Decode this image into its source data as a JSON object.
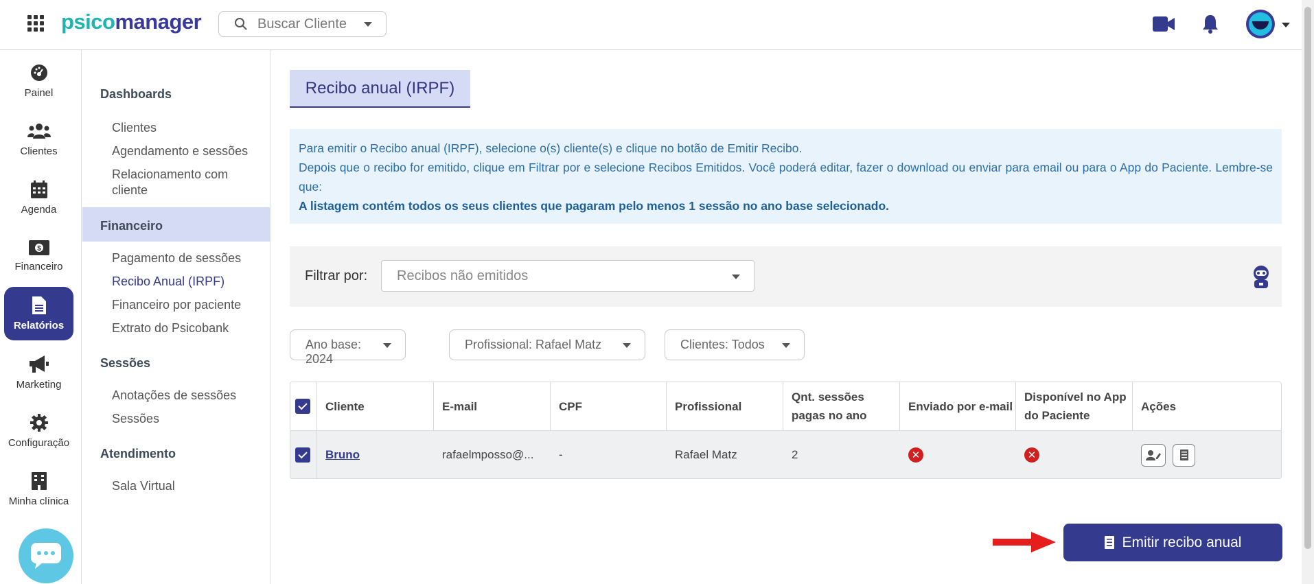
{
  "app": {
    "logo_a": "psico",
    "logo_b": "manager"
  },
  "search": {
    "placeholder": "Buscar Cliente"
  },
  "leftnav": [
    {
      "label": "Painel",
      "icon": "dashboard-gauge-icon"
    },
    {
      "label": "Clientes",
      "icon": "users-icon"
    },
    {
      "label": "Agenda",
      "icon": "calendar-icon"
    },
    {
      "label": "Financeiro",
      "icon": "money-icon"
    },
    {
      "label": "Relatórios",
      "icon": "document-icon",
      "active": true
    },
    {
      "label": "Marketing",
      "icon": "megaphone-icon"
    },
    {
      "label": "Configuração",
      "icon": "gear-icon"
    },
    {
      "label": "Minha clínica",
      "icon": "building-icon"
    }
  ],
  "submenu": {
    "dashboards": {
      "title": "Dashboards",
      "items": [
        "Clientes",
        "Agendamento e sessões",
        "Relacionamento com cliente"
      ]
    },
    "financeiro": {
      "title": "Financeiro",
      "items": [
        "Pagamento de sessões",
        "Recibo Anual (IRPF)",
        "Financeiro por paciente",
        "Extrato do Psicobank"
      ]
    },
    "sessoes": {
      "title": "Sessões",
      "items": [
        "Anotações de sessões",
        "Sessões"
      ]
    },
    "atendimento": {
      "title": "Atendimento",
      "items": [
        "Sala Virtual"
      ]
    }
  },
  "page": {
    "tab_title": "Recibo anual (IRPF)",
    "info_line1": "Para emitir o Recibo anual (IRPF), selecione o(s) cliente(s) e clique no botão de Emitir Recibo.",
    "info_line2": "Depois que o recibo for emitido, clique em Filtrar por e selecione Recibos Emitidos. Você poderá editar, fazer o download ou enviar para email ou para o App do Paciente. Lembre-se que:",
    "info_bold": "A listagem contém todos os seus clientes que pagaram pelo menos 1 sessão no ano base selecionado."
  },
  "filter": {
    "label": "Filtrar por:",
    "value": "Recibos não emitidos"
  },
  "pills": {
    "ano": "Ano base: 2024",
    "profissional": "Profissional: Rafael Matz",
    "clientes": "Clientes: Todos"
  },
  "table": {
    "headers": {
      "cliente": "Cliente",
      "email": "E-mail",
      "cpf": "CPF",
      "profissional": "Profissional",
      "qnt": "Qnt. sessões pagas no ano",
      "enviado": "Enviado por e-mail",
      "disponivel": "Disponível no App do Paciente",
      "acoes": "Ações"
    },
    "rows": [
      {
        "cliente": "Bruno",
        "email": "rafaelmposso@...",
        "cpf": "-",
        "profissional": "Rafael Matz",
        "qnt": "2",
        "enviado": false,
        "disponivel": false
      }
    ]
  },
  "emit_button": {
    "label": "Emitir recibo anual"
  },
  "colors": {
    "primary": "#343a8d",
    "accent": "#1fb4b1",
    "info_bg": "#e8f3fc",
    "danger": "#d11f1f"
  }
}
